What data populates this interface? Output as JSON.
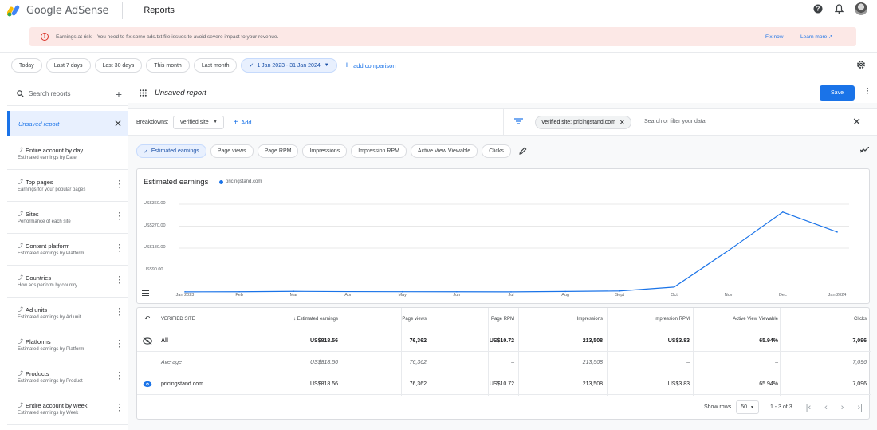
{
  "app": {
    "name": "Google AdSense",
    "section": "Reports"
  },
  "alert": {
    "text": "Earnings at risk – You need to fix some ads.txt file issues to avoid severe impact to your revenue.",
    "fix_label": "Fix now",
    "learn_label": "Learn more ↗"
  },
  "date_filters": [
    "Today",
    "Last 7 days",
    "Last 30 days",
    "This month",
    "Last month"
  ],
  "date_range": "1 Jan 2023 - 31 Jan 2024",
  "add_comparison": "add comparison",
  "sidebar": {
    "search_placeholder": "Search reports",
    "active": "Unsaved report",
    "items": [
      {
        "title": "Entire account by day",
        "subtitle": "Estimated earnings by Date"
      },
      {
        "title": "Top pages",
        "subtitle": "Earnings for your popular pages"
      },
      {
        "title": "Sites",
        "subtitle": "Performance of each site"
      },
      {
        "title": "Content platform",
        "subtitle": "Estimated earnings by Platform..."
      },
      {
        "title": "Countries",
        "subtitle": "How ads perform by country"
      },
      {
        "title": "Ad units",
        "subtitle": "Estimated earnings by Ad unit"
      },
      {
        "title": "Platforms",
        "subtitle": "Estimated earnings by Platform"
      },
      {
        "title": "Products",
        "subtitle": "Estimated earnings by Product"
      },
      {
        "title": "Entire account by week",
        "subtitle": "Estimated earnings by Week"
      }
    ]
  },
  "report": {
    "title": "Unsaved report",
    "save_label": "Save",
    "breakdowns_label": "Breakdowns:",
    "breakdown_value": "Verified site",
    "add_label": "Add",
    "filter_chip": "Verified site: pricingstand.com",
    "filter_placeholder": "Search or filter your data"
  },
  "metrics": [
    "Estimated earnings",
    "Page views",
    "Page RPM",
    "Impressions",
    "Impression RPM",
    "Active View Viewable",
    "Clicks"
  ],
  "chart_data": {
    "type": "line",
    "title": "Estimated earnings",
    "x": [
      "Jan 2023",
      "Feb",
      "Mar",
      "Apr",
      "May",
      "Jun",
      "Jul",
      "Aug",
      "Sept",
      "Oct",
      "Nov",
      "Dec",
      "Jan 2024"
    ],
    "series": [
      {
        "name": "pricingstand.com",
        "color": "#1a73e8",
        "values": [
          0.5,
          0.8,
          2.5,
          1.5,
          1.0,
          0.8,
          0.3,
          2.0,
          4.0,
          20.0,
          170.0,
          328.0,
          246.0
        ]
      }
    ],
    "yticks": [
      "US$0.00",
      "US$90.00",
      "US$180.00",
      "US$270.00",
      "US$360.00"
    ],
    "ylim": [
      0,
      360
    ],
    "grid": true
  },
  "table": {
    "headers": [
      "VERIFIED SITE",
      "↓ Estimated earnings",
      "Page views",
      "Page RPM",
      "Impressions",
      "Impression RPM",
      "Active View Viewable",
      "Clicks"
    ],
    "rows": [
      [
        "All",
        "US$818.56",
        "76,362",
        "US$10.72",
        "213,508",
        "US$3.83",
        "65.94%",
        "7,096"
      ],
      [
        "Average",
        "US$818.56",
        "76,362",
        "–",
        "213,508",
        "–",
        "–",
        "7,096"
      ],
      [
        "pricingstand.com",
        "US$818.56",
        "76,362",
        "US$10.72",
        "213,508",
        "US$3.83",
        "65.94%",
        "7,096"
      ]
    ],
    "show_rows_label": "Show rows",
    "rows_per_page": "50",
    "range": "1 - 3 of 3"
  }
}
